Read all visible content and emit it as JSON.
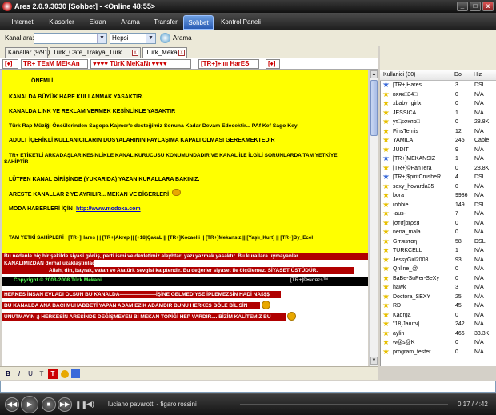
{
  "window": {
    "title": "Ares 2.0.9.3030   [Sohbet]   - <Online 48:55>",
    "minimize": "_",
    "maximize": "□",
    "close": "x"
  },
  "menu": {
    "tabs": [
      {
        "label": "Internet"
      },
      {
        "label": "Klasorler"
      },
      {
        "label": "Ekran"
      },
      {
        "label": "Arama"
      },
      {
        "label": "Transfer"
      },
      {
        "label": "Sohbet"
      },
      {
        "label": "Kontrol Paneli"
      }
    ],
    "active": "Sohbet"
  },
  "search": {
    "label": "Kanal ara:",
    "value": "",
    "filter": "Hepsi",
    "button": "Arama"
  },
  "channel_tabs": [
    {
      "label": "Kanallar (9/91)"
    },
    {
      "label": "Turk_Cafe_Trakya_Türk"
    },
    {
      "label": "Turk_Mekani"
    }
  ],
  "banner": {
    "seg1": "[♦]",
    "seg2": "TR+ TEaM MEI<An",
    "seg3": "♥♥♥♥ TürK MeKaNı ♥♥♥♥",
    "seg4": "[TR+]+ıııı HarES",
    "seg5": "[♦]"
  },
  "chat": {
    "lines": [
      "ÖNEMLİ",
      "KANALDA BÜYÜK HARF KULLANMAK YASAKTIR.",
      "KANALDA LİNK VE REKLAM VERMEK KESİNLİKLE YASAKTIR",
      "Türk Rap Müziği Öncülerinden Sagopa Kajmer'e desteğimiz Sonuna Kadar Devam Edecektir... PAf Kef Sago Key",
      "ADULT İÇERİKLİ KULLANICILARIN DOSYALARININ PAYLAŞIMA KAPALI OLMASI GEREKMEKTEDİR",
      "TR+ ETİKETLİ ARKADAŞLAR KESİNLİKLE KANAL KURUCUSU KONUMUNDADIR VE KANAL İLE İLGİLİ SORUNLARDA TAM YETKİYE",
      "SAHİPTİR",
      "LÜTFEN KANAL GİRİŞİNDE (YUKARIDA) YAZAN KURALLARA BAKINIZ.",
      "ARESTE KANALLAR 2 YE AYRILIR... MEKAN VE DİGERLERİ",
      "MODA HABERLERİ İÇİN",
      "TAM YETKİ SAHİPLERİ : [TR+]Hares | | [TR+]Akrep || [+18]ÇakaL || [TR+]Kocaelli || [TR+]Mekansız || [Yaşlı_Kurt] || [TR+]By_Ecel"
    ],
    "link": "http://www.modoxa.com",
    "red1": "Bu nedenle hiç bir şekilde siyasi görüş, parti ismi ve devletimiz aleyhtarı yazı yazmak yasaktır. Bu kurallara uymayanlar",
    "red2": "KANALIMIZDAN derhal uzaklaştırılacaktır.",
    "red3": "Allah, din, bayrak, vatan ve Atatürk sevgisi kalptendir. Bu değerler siyaset ile ölçülemez. SİYASET ÜSTÜDÜR.",
    "copyright": "Copyright © 2003-2008 Türk Mekani",
    "host": "[TR+]©•нαяєѕ™",
    "red4": "HERKES İNSAN EVLADI OLSUN BU KANALDA———————İŞİNE GELMEDİYSE İPLEMEZSİN HADİ NA$$$",
    "red5": "BU KANALDA ANA BACI MUHABBETİ YAPAN ADAM EZİK ADAMDIR BUNU HERKES BÖLE BİL SİN",
    "red6": "UNUTMAYIN ;) HERKESİN ARESİNDE DEĞİŞMEYEN Bİ MEKAN TOPİĞİ HEP VARDIR.... BİZİM KALİTEMİZ BU"
  },
  "format_bar": {
    "bold": "B",
    "italic": "I",
    "underline": "U"
  },
  "users": {
    "header": {
      "name": "Kullanici (30)",
      "files": "Do",
      "speed": "Hiz"
    },
    "rows": [
      {
        "name": "[TR+]Hares",
        "files": "3",
        "speed": "DSL",
        "color": "#3a6ad9"
      },
      {
        "name": "вяяк□34□",
        "files": "0",
        "speed": "N/A",
        "color": "#e8c000"
      },
      {
        "name": "xbaby_girlx",
        "files": "0",
        "speed": "N/A",
        "color": "#e8c000"
      },
      {
        "name": "JESSICA....",
        "files": "1",
        "speed": "N/A",
        "color": "#e8c000"
      },
      {
        "name": "уτ□ʂσκяρ□",
        "files": "0",
        "speed": "28.8K",
        "color": "#e8c000"
      },
      {
        "name": "FinsTernis",
        "files": "12",
        "speed": "N/A",
        "color": "#e8c000"
      },
      {
        "name": "YAMILA",
        "files": "245",
        "speed": "Cable",
        "color": "#e8c000"
      },
      {
        "name": "JUDIT",
        "files": "9",
        "speed": "N/A",
        "color": "#e8c000"
      },
      {
        "name": "[TR+]MEKANSIZ",
        "files": "1",
        "speed": "N/A",
        "color": "#3a6ad9"
      },
      {
        "name": "[TR+]©PanTera",
        "files": "0",
        "speed": "28.8K",
        "color": "#e8c000"
      },
      {
        "name": "[TR+]$piritCrusheR",
        "files": "4",
        "speed": "DSL",
        "color": "#3a6ad9"
      },
      {
        "name": "sexy_hovarda35",
        "files": "0",
        "speed": "N/A",
        "color": "#e8c000"
      },
      {
        "name": "bora",
        "files": "9986",
        "speed": "N/A",
        "color": "#e8c000"
      },
      {
        "name": "robbie",
        "files": "149",
        "speed": "DSL",
        "color": "#e8c000"
      },
      {
        "name": "-aus-",
        "files": "7",
        "speed": "N/A",
        "color": "#e8c000"
      },
      {
        "name": "[σтσ]αℓρєя",
        "files": "0",
        "speed": "N/A",
        "color": "#e8c000"
      },
      {
        "name": "nena_mala",
        "files": "0",
        "speed": "N/A",
        "color": "#e8c000"
      },
      {
        "name": "Gιтяιѕтαη",
        "files": "58",
        "speed": "DSL",
        "color": "#e8c000"
      },
      {
        "name": "TURKCELL",
        "files": "1",
        "speed": "N/A",
        "color": "#e8c000"
      },
      {
        "name": "JessyGirl2008",
        "files": "93",
        "speed": "N/A",
        "color": "#e8c000"
      },
      {
        "name": "Qnline_@",
        "files": "0",
        "speed": "N/A",
        "color": "#e8c000"
      },
      {
        "name": "BaBe-SuPer-SeXy",
        "files": "0",
        "speed": "N/A",
        "color": "#e8c000"
      },
      {
        "name": "hawk",
        "files": "3",
        "speed": "N/A",
        "color": "#e8c000"
      },
      {
        "name": "Doctora_SEXY",
        "files": "25",
        "speed": "N/A",
        "color": "#e8c000"
      },
      {
        "name": "RD",
        "files": "45",
        "speed": "N/A",
        "color": "#e8c000"
      },
      {
        "name": "Kadrga",
        "files": "0",
        "speed": "N/A",
        "color": "#e8c000"
      },
      {
        "name": "\"18]Jaшτч|",
        "files": "242",
        "speed": "N/A",
        "color": "#e8c000"
      },
      {
        "name": "aylin",
        "files": "466",
        "speed": "33.3K",
        "color": "#e8c000"
      },
      {
        "name": "w@s@K",
        "files": "0",
        "speed": "N/A",
        "color": "#e8c000"
      },
      {
        "name": "program_tester",
        "files": "0",
        "speed": "N/A",
        "color": "#e8c000"
      }
    ]
  },
  "player": {
    "track": "luciano pavarotti - figaro  rossini",
    "time": "0:17 / 4:42"
  }
}
